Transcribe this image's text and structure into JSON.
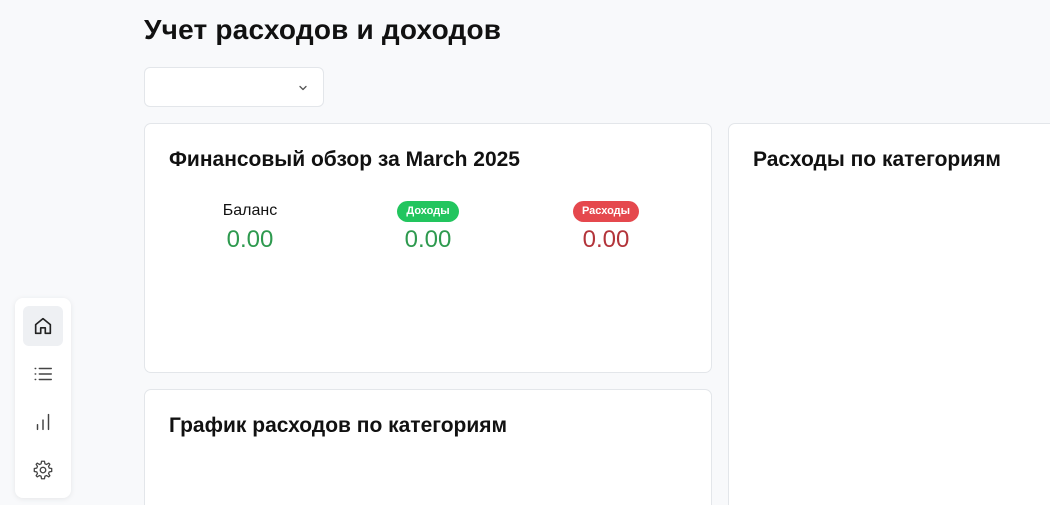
{
  "header": {
    "title": "Учет расходов и доходов"
  },
  "period_select": {
    "value": "",
    "icon": "chevron-down-icon"
  },
  "overview": {
    "title": "Финансовый обзор за March 2025",
    "balance": {
      "label": "Баланс",
      "value": "0.00",
      "color": "#2e9a4f"
    },
    "income": {
      "label": "Доходы",
      "value": "0.00",
      "badge_color": "#22c55e",
      "color": "#2e9a4f"
    },
    "expense": {
      "label": "Расходы",
      "value": "0.00",
      "badge_color": "#e5484d",
      "color": "#b3343a"
    }
  },
  "categories_card": {
    "title": "Расходы по категориям"
  },
  "chart_card": {
    "title": "График расходов по категориям"
  },
  "sidebar": {
    "items": [
      {
        "name": "home",
        "icon": "home-icon",
        "active": true
      },
      {
        "name": "list",
        "icon": "list-icon",
        "active": false
      },
      {
        "name": "stats",
        "icon": "bar-chart-icon",
        "active": false
      },
      {
        "name": "settings",
        "icon": "gear-icon",
        "active": false
      }
    ]
  }
}
